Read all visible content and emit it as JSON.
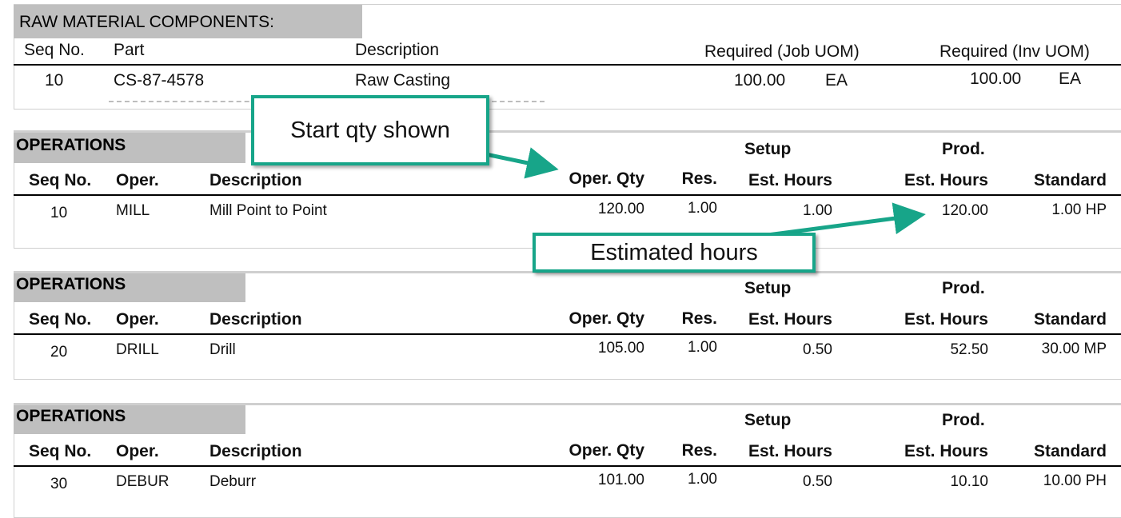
{
  "raw_material": {
    "title": "RAW MATERIAL COMPONENTS:",
    "headers": {
      "seq": "Seq No.",
      "part": "Part",
      "description": "Description",
      "required_job": "Required (Job UOM)",
      "required_inv": "Required (Inv UOM)"
    },
    "row": {
      "seq": "10",
      "part": "CS-87-4578",
      "description": "Raw Casting",
      "job_qty": "100.00",
      "job_uom": "EA",
      "inv_qty": "100.00",
      "inv_uom": "EA"
    }
  },
  "operations_headers": {
    "title": "OPERATIONS",
    "setup": "Setup",
    "prod": "Prod.",
    "seq": "Seq No.",
    "oper": "Oper.",
    "description": "Description",
    "oper_qty": "Oper. Qty",
    "res": "Res.",
    "setup_hours": "Est. Hours",
    "prod_hours": "Est. Hours",
    "standard": "Standard"
  },
  "operations": [
    {
      "seq": "10",
      "oper": "MILL",
      "description": "Mill Point to Point",
      "oper_qty": "120.00",
      "res": "1.00",
      "setup_hours": "1.00",
      "prod_hours": "120.00",
      "standard": "1.00 HP"
    },
    {
      "seq": "20",
      "oper": "DRILL",
      "description": "Drill",
      "oper_qty": "105.00",
      "res": "1.00",
      "setup_hours": "0.50",
      "prod_hours": "52.50",
      "standard": "30.00 MP"
    },
    {
      "seq": "30",
      "oper": "DEBUR",
      "description": "Deburr",
      "oper_qty": "101.00",
      "res": "1.00",
      "setup_hours": "0.50",
      "prod_hours": "10.10",
      "standard": "10.00 PH"
    }
  ],
  "callouts": {
    "start_qty": "Start qty shown",
    "estimated_hours": "Estimated hours"
  },
  "colors": {
    "callout_border": "#17a589",
    "section_bar": "#bfbfbf"
  }
}
